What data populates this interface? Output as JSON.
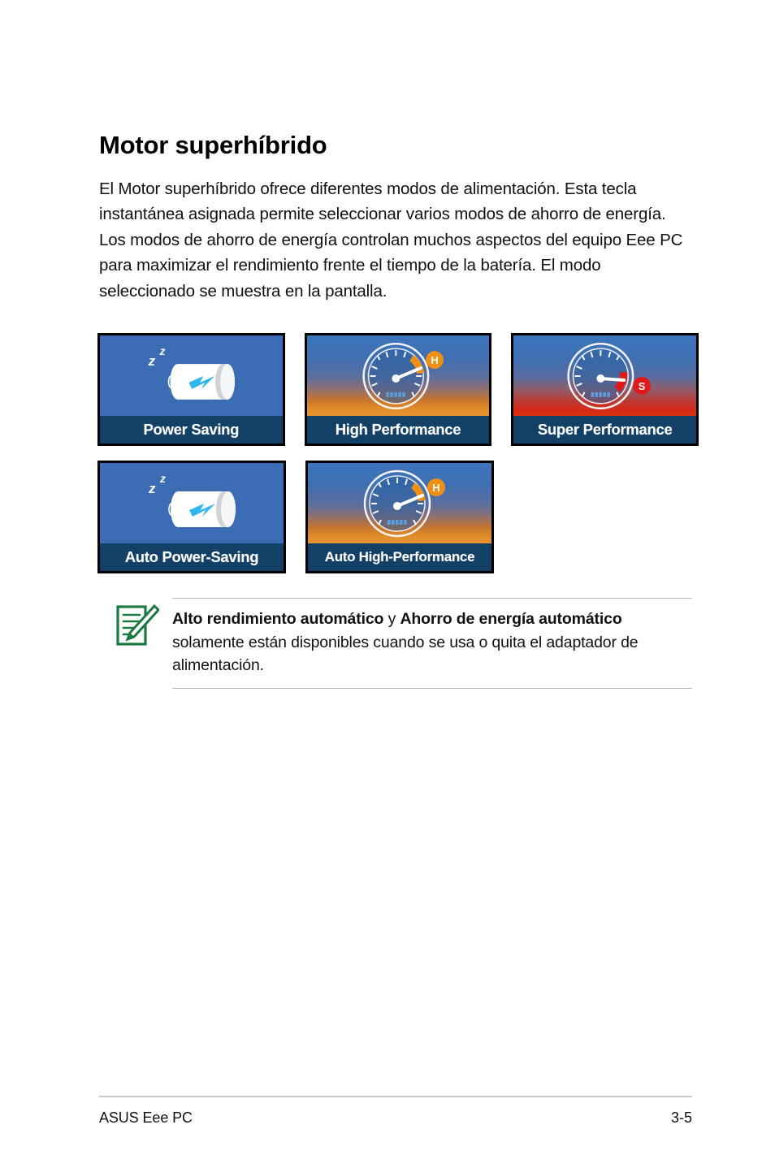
{
  "page": {
    "heading": "Motor superhíbrido",
    "body": "El Motor superhíbrido ofrece diferentes modos de alimentación. Esta tecla instantánea asignada permite seleccionar varios modos de ahorro de energía. Los modos de ahorro de energía controlan muchos aspectos del equipo Eee PC para maximizar el rendimiento frente el tiempo de la batería. El modo seleccionado se muestra en la pantalla."
  },
  "tiles": {
    "row1": [
      {
        "id": "power-saving",
        "label": "Power Saving",
        "art": "battery-sleep",
        "bg": "ps"
      },
      {
        "id": "high-performance",
        "label": "High Performance",
        "art": "gauge-h",
        "bg": "hp"
      },
      {
        "id": "super-performance",
        "label": "Super Performance",
        "art": "gauge-s",
        "bg": "sp"
      }
    ],
    "row2": [
      {
        "id": "auto-power-saving",
        "label": "Auto Power-Saving",
        "art": "battery-sleep",
        "bg": "ps"
      },
      {
        "id": "auto-high-performance",
        "label": "Auto High-Performance",
        "art": "gauge-h",
        "bg": "hp"
      }
    ]
  },
  "note": {
    "bold1": "Alto rendimiento automático",
    "conj": " y ",
    "bold2": "Ahorro de energía automático",
    "rest": " solamente están disponibles cuando se usa o quita el adaptador de alimentación."
  },
  "footer": {
    "left": "ASUS Eee PC",
    "right": "3-5"
  },
  "colors": {
    "tile_blue": "#3c6cb4",
    "label_navy": "#124066",
    "badge_orange": "#ef8f14",
    "badge_red": "#e01a1a",
    "note_green": "#1b7a42",
    "rule_gray": "#b7b7b7"
  },
  "badges": {
    "high": "H",
    "super": "S"
  }
}
